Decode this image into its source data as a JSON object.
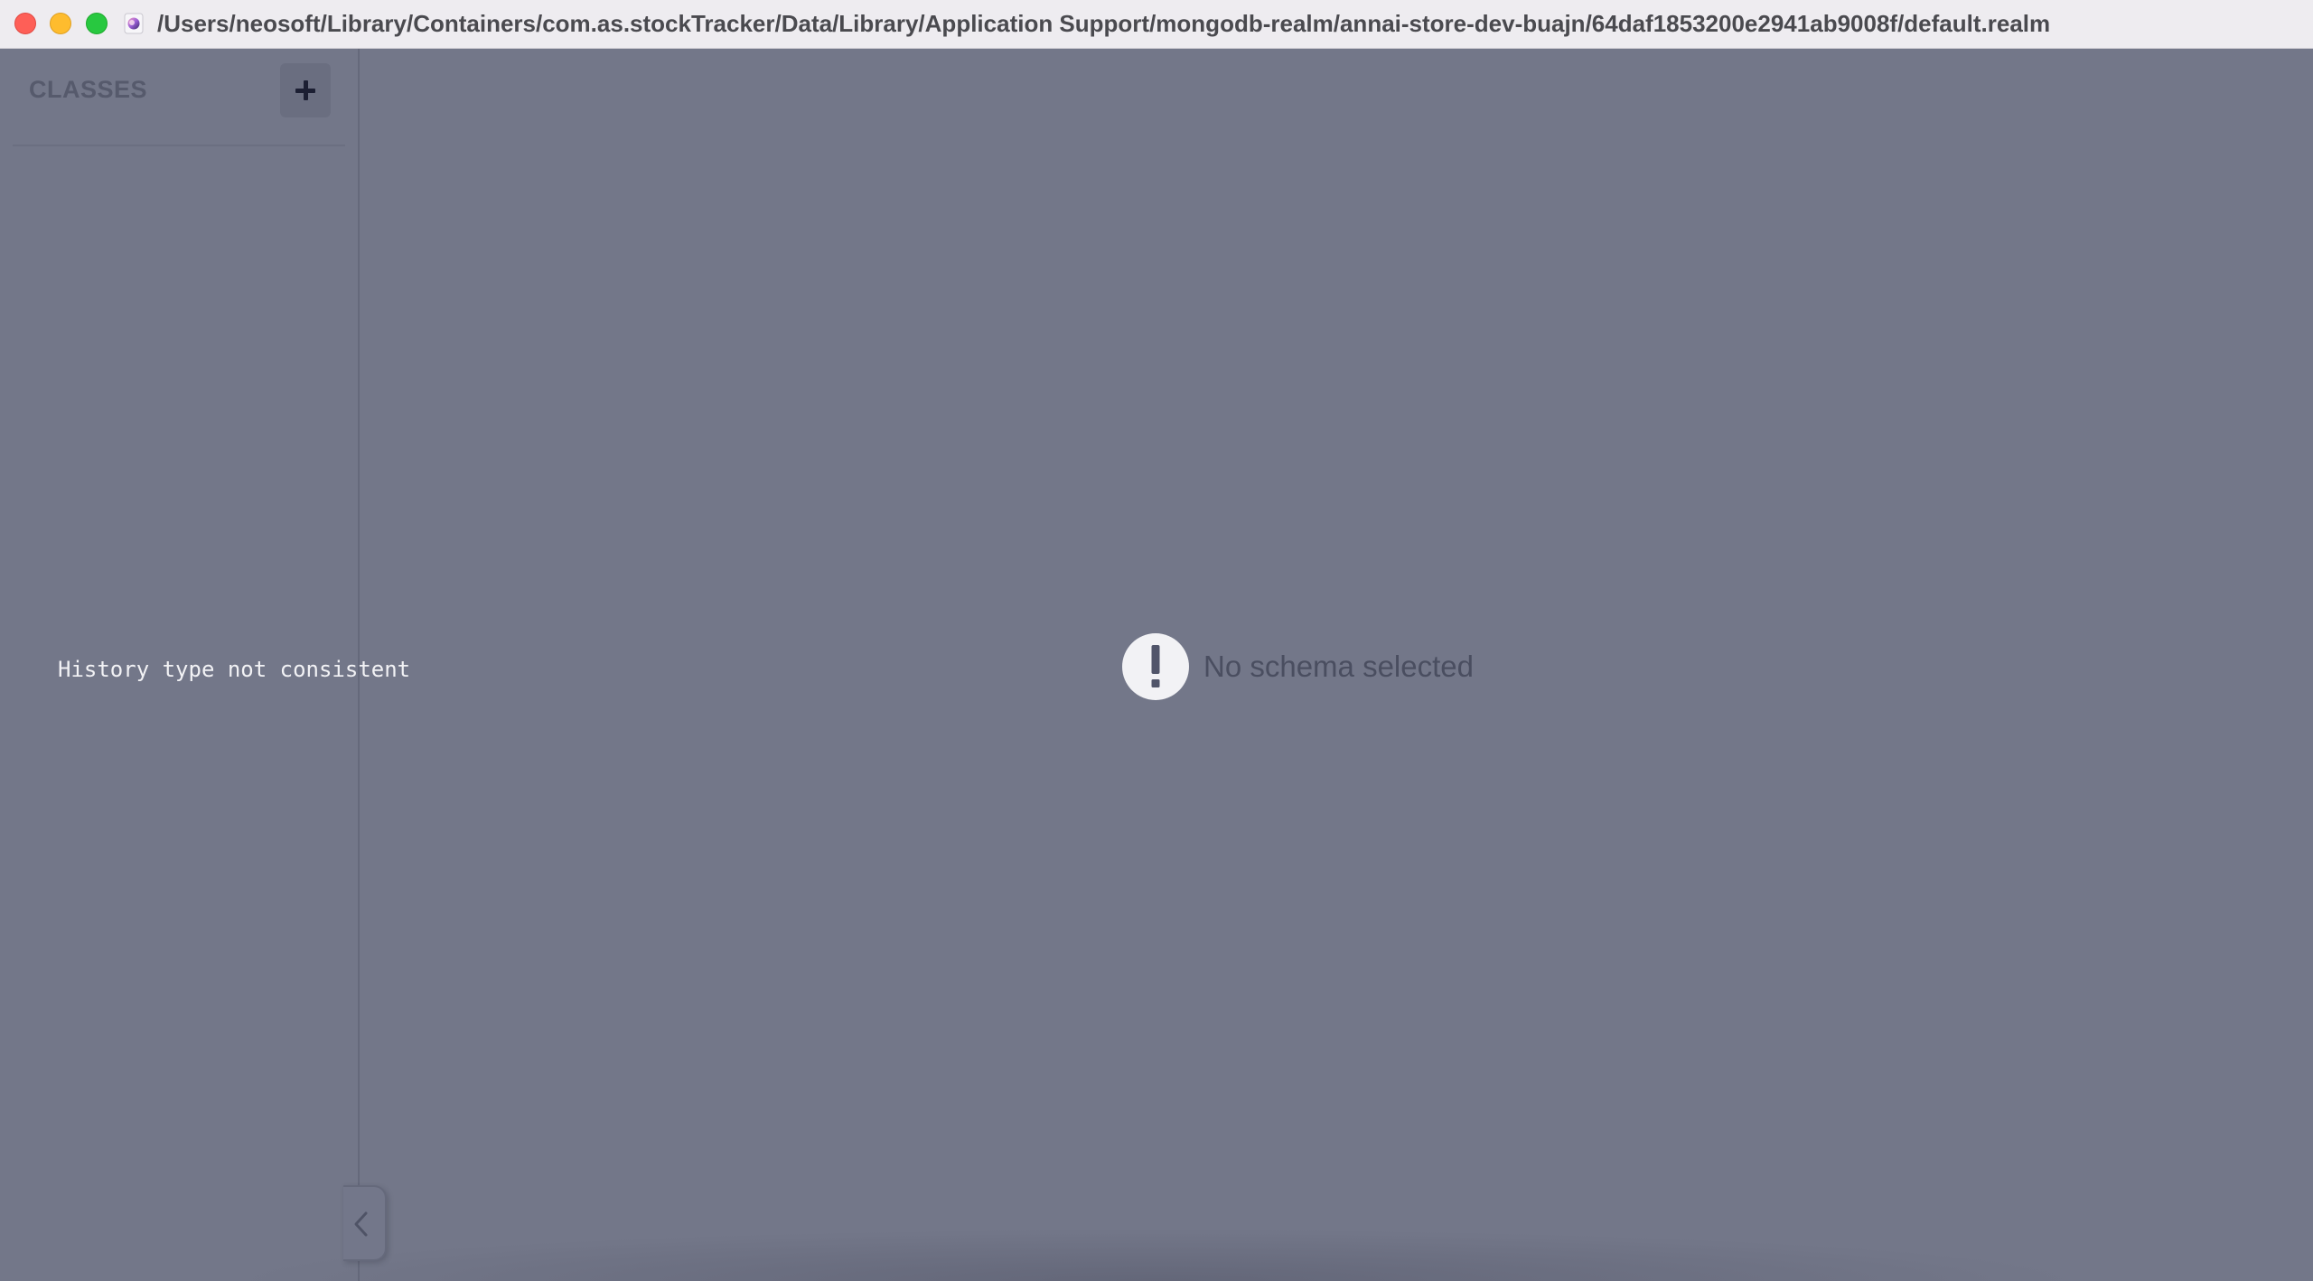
{
  "titlebar": {
    "title": "/Users/neosoft/Library/Containers/com.as.stockTracker/Data/Library/Application Support/mongodb-realm/annai-store-dev-buajn/64daf1853200e2941ab9008f/default.realm",
    "buttons": [
      "close",
      "minimize",
      "zoom"
    ],
    "icon": "realm-document-icon"
  },
  "sidebar": {
    "header_label": "CLASSES",
    "add_button_icon": "plus-icon",
    "error_message": "History type not consistent",
    "collapse_icon": "chevron-left-icon"
  },
  "main": {
    "empty_icon": "exclamation-icon",
    "empty_message": "No schema selected"
  },
  "colors": {
    "background": "#737789",
    "titlebar": "#eeecf0",
    "close": "#fe5f57",
    "minimize": "#febc2e",
    "zoom": "#28c840"
  }
}
